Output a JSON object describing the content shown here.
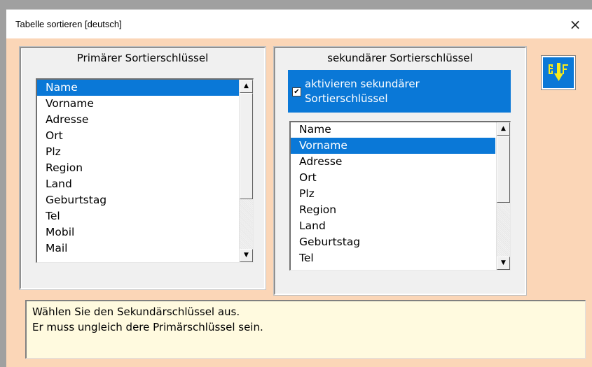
{
  "window": {
    "title": "Tabelle sortieren  [deutsch]",
    "close_label": "×"
  },
  "primary": {
    "label": "Primärer Sortierschlüssel",
    "items": [
      "Name",
      "Vorname",
      "Adresse",
      "Ort",
      "Plz",
      "Region",
      "Land",
      "Geburtstag",
      "Tel",
      "Mobil",
      "Mail"
    ],
    "selected_value": "Name"
  },
  "secondary": {
    "label": "sekundärer Sortierschlüssel",
    "checkbox_label_line1": "aktivieren sekundärer",
    "checkbox_label_line2": "Sortierschlüssel",
    "checkbox_checked": true,
    "items": [
      "Name",
      "Vorname",
      "Adresse",
      "Ort",
      "Plz",
      "Region",
      "Land",
      "Geburtstag",
      "Tel"
    ],
    "selected_value": "Vorname"
  },
  "sort_button": {
    "icon": "sort-descending-icon"
  },
  "message": {
    "line1": "Wählen Sie den Sekundärschlüssel aus.",
    "line2": "Er muss ungleich dere Primärschlüssel sein."
  },
  "colors": {
    "accent": "#0a78d7",
    "background": "#fbd6b7",
    "message_bg": "#fffadf",
    "icon_yellow": "#f7ea1c"
  }
}
